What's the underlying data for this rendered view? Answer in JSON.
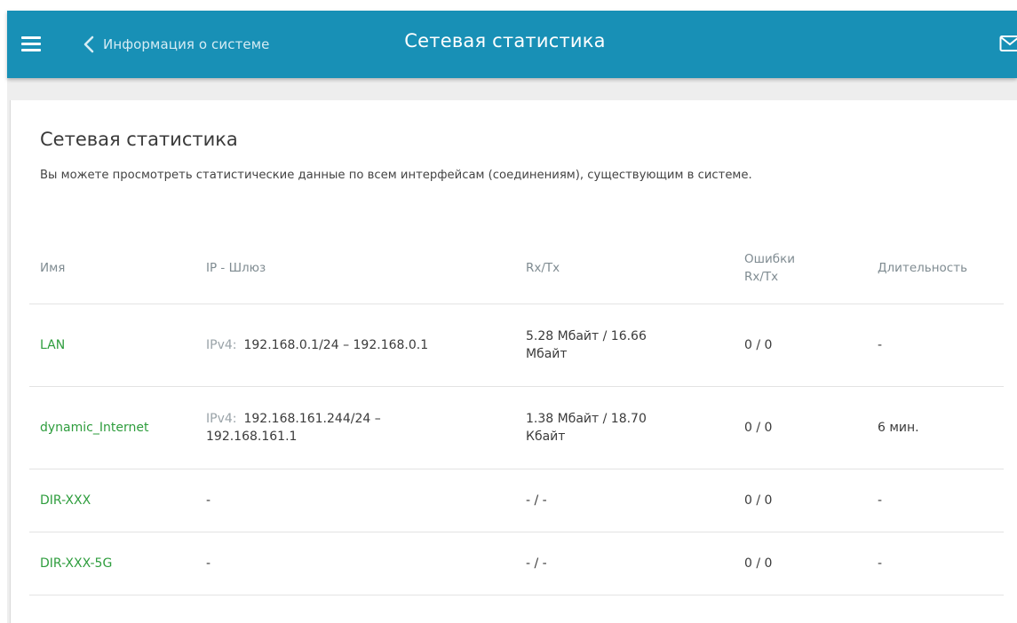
{
  "header": {
    "back_label": "Информация о системе",
    "title": "Сетевая статистика",
    "bg_color": "#1890b6"
  },
  "content": {
    "heading": "Сетевая статистика",
    "description": "Вы можете просмотреть статистические данные по всем интерфейсам (соединениям), существующим в системе."
  },
  "table": {
    "columns": {
      "name": "Имя",
      "ip": "IP - Шлюз",
      "rxtx": "Rx/Tx",
      "errors_line1": "Ошибки",
      "errors_line2": "Rx/Tx",
      "duration": "Длительность"
    },
    "rows": [
      {
        "name": "LAN",
        "ip_prefix": "IPv4:",
        "ip": "192.168.0.1/24 – 192.168.0.1",
        "ip_line2": "",
        "rxtx": "5.28 Мбайт / 16.66",
        "rxtx_line2": "Мбайт",
        "errors": "0 / 0",
        "duration": "-"
      },
      {
        "name": "dynamic_Internet",
        "ip_prefix": "IPv4:",
        "ip": "192.168.161.244/24 –",
        "ip_line2": "192.168.161.1",
        "rxtx": "1.38 Мбайт / 18.70",
        "rxtx_line2": "Кбайт",
        "errors": "0 / 0",
        "duration": "6 мин."
      },
      {
        "name": "DIR-XXX",
        "ip": "-",
        "rxtx": "- / -",
        "errors": "0 / 0",
        "duration": "-"
      },
      {
        "name": "DIR-XXX-5G",
        "ip": "-",
        "rxtx": "- / -",
        "errors": "0 / 0",
        "duration": "-"
      }
    ]
  },
  "icons": [
    "menu-icon",
    "chevron-left-icon",
    "mail-icon"
  ],
  "colors": {
    "link_green": "#2e9d3d"
  }
}
